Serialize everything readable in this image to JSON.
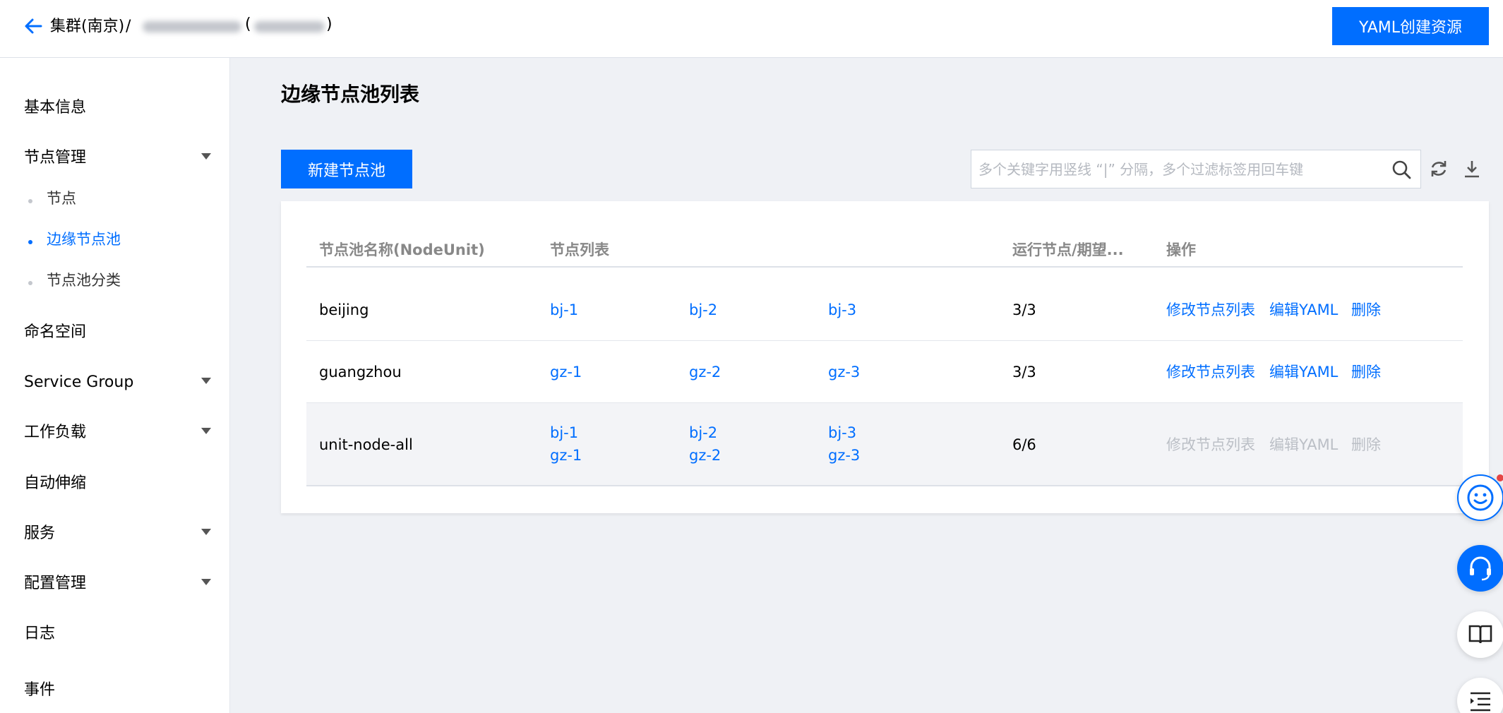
{
  "header": {
    "breadcrumb_root": "集群(南京)",
    "breadcrumb_sep": "/",
    "yaml_button": "YAML创建资源"
  },
  "sidebar": {
    "items": [
      {
        "label": "基本信息"
      },
      {
        "label": "节点管理"
      },
      {
        "label": "命名空间"
      },
      {
        "label": "Service Group"
      },
      {
        "label": "工作负载"
      },
      {
        "label": "自动伸缩"
      },
      {
        "label": "服务"
      },
      {
        "label": "配置管理"
      },
      {
        "label": "日志"
      },
      {
        "label": "事件"
      }
    ],
    "sub_items": [
      {
        "label": "节点"
      },
      {
        "label": "边缘节点池"
      },
      {
        "label": "节点池分类"
      }
    ]
  },
  "main": {
    "title": "边缘节点池列表",
    "new_button": "新建节点池",
    "search_placeholder": "多个关键字用竖线 “|” 分隔，多个过滤标签用回车键"
  },
  "table": {
    "headers": [
      "节点池名称(NodeUnit)",
      "节点列表",
      "运行节点/期望...",
      "操作"
    ],
    "rows": [
      {
        "name": "beijing",
        "nodes": [
          "bj-1",
          "bj-2",
          "bj-3"
        ],
        "count": "3/3",
        "ops": [
          "修改节点列表",
          "编辑YAML",
          "删除"
        ]
      },
      {
        "name": "guangzhou",
        "nodes": [
          "gz-1",
          "gz-2",
          "gz-3"
        ],
        "count": "3/3",
        "ops": [
          "修改节点列表",
          "编辑YAML",
          "删除"
        ]
      },
      {
        "name": "unit-node-all",
        "nodes": [
          "bj-1",
          "bj-2",
          "bj-3",
          "gz-1",
          "gz-2",
          "gz-3"
        ],
        "count": "6/6",
        "ops": [
          "修改节点列表",
          "编辑YAML",
          "删除"
        ]
      }
    ]
  },
  "colors": {
    "accent": "#006eff",
    "disabled_text": "#bbbfc6",
    "notification_dot": "#e54545"
  },
  "icons": [
    "back-arrow-icon",
    "search-icon",
    "refresh-icon",
    "download-icon",
    "smiley-icon",
    "headset-icon",
    "book-icon",
    "list-icon"
  ]
}
